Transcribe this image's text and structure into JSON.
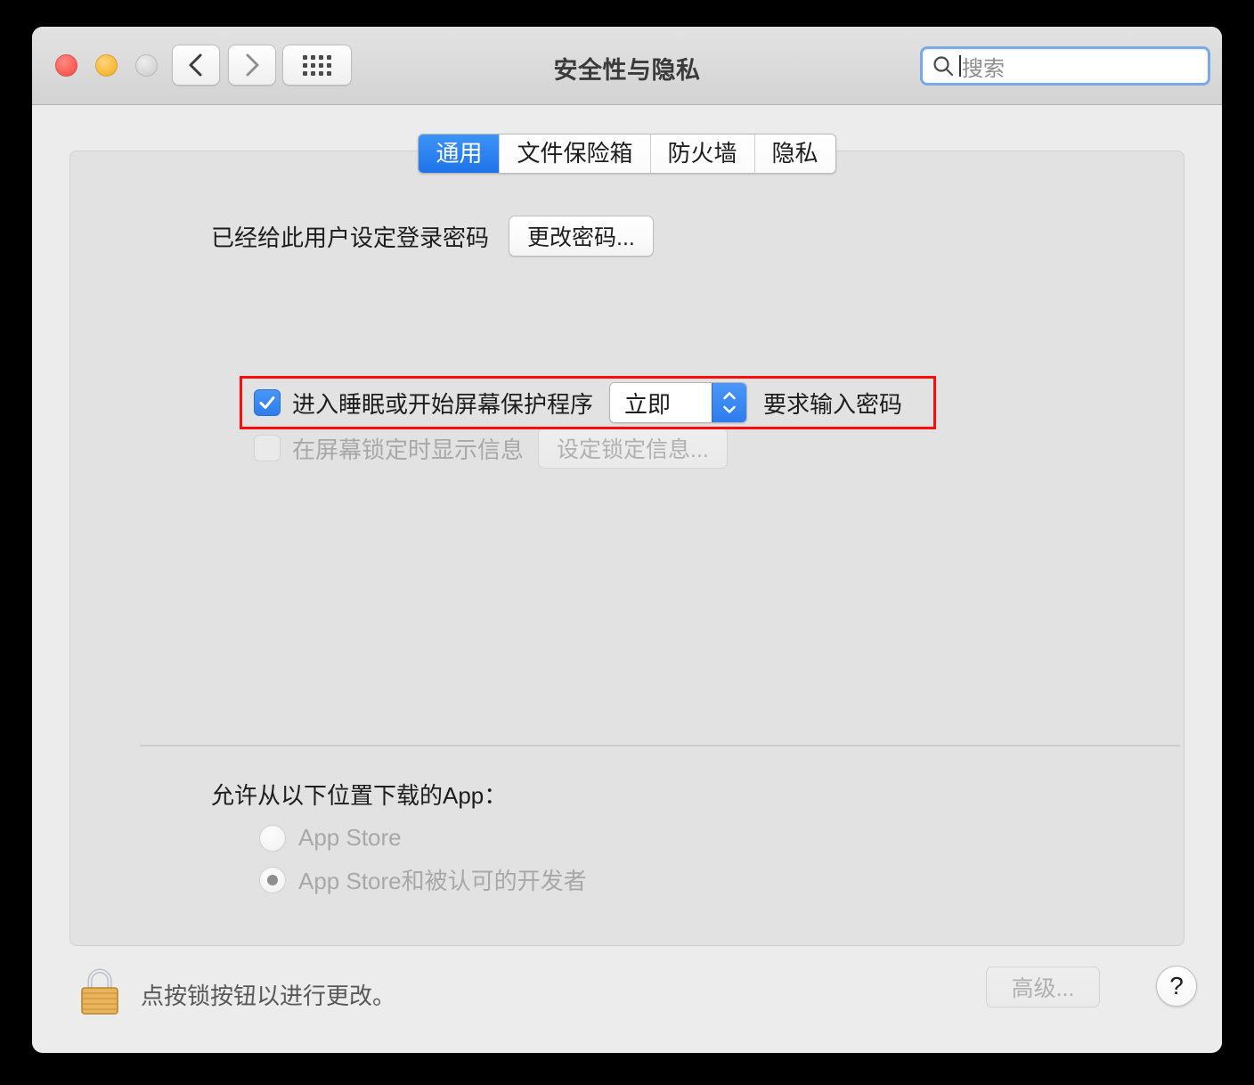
{
  "window": {
    "title": "安全性与隐私",
    "traffic_lights": [
      "close",
      "minimize",
      "zoom"
    ],
    "nav": {
      "back": "back-chevron",
      "forward": "forward-chevron",
      "grid": "show-all-grid"
    }
  },
  "search": {
    "placeholder": "搜索",
    "icon": "search-icon",
    "focused": true
  },
  "tabs": [
    {
      "label": "通用",
      "active": true
    },
    {
      "label": "文件保险箱",
      "active": false
    },
    {
      "label": "防火墙",
      "active": false
    },
    {
      "label": "隐私",
      "active": false
    }
  ],
  "general": {
    "password_row": {
      "label": "已经给此用户设定登录密码",
      "button": "更改密码..."
    },
    "require_password_row": {
      "checked": true,
      "label": "进入睡眠或开始屏幕保护程序",
      "delay_value": "立即",
      "suffix": "要求输入密码",
      "highlighted": true
    },
    "lock_message_row": {
      "checked": false,
      "enabled": false,
      "label": "在屏幕锁定时显示信息",
      "button": "设定锁定信息..."
    },
    "download_section": {
      "title": "允许从以下位置下载的App：",
      "options": [
        {
          "label": "App Store",
          "selected": false
        },
        {
          "label": "App Store和被认可的开发者",
          "selected": true
        }
      ],
      "enabled": false
    }
  },
  "footer": {
    "lock_icon": "lock-closed-icon",
    "note": "点按锁按钮以进行更改。",
    "advanced_button": "高级...",
    "advanced_enabled": false,
    "help_button": "?"
  },
  "colors": {
    "accent": "#2e7ced",
    "highlight": "#fb0d0d",
    "panel": "#e2e2e2",
    "window": "#ececec"
  }
}
